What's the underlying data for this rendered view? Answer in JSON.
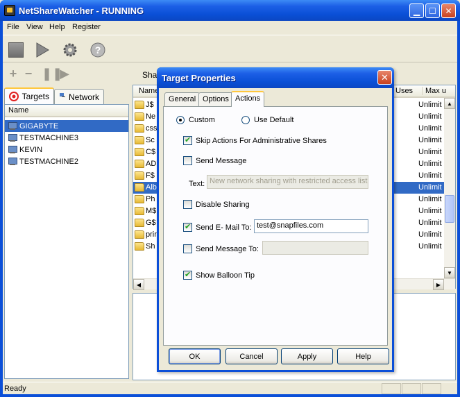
{
  "window": {
    "title": "NetShareWatcher - RUNNING"
  },
  "menu": [
    "File",
    "View",
    "Help",
    "Register"
  ],
  "toolbar": [
    "stop-icon",
    "play-icon",
    "settings-icon",
    "help-icon"
  ],
  "left_tabs": {
    "targets": "Targets",
    "network": "Network"
  },
  "target_list": {
    "header": "Name",
    "items": [
      "GIGABYTE",
      "TESTMACHINE3",
      "KEVIN",
      "TESTMACHINE2"
    ],
    "selected_index": 0
  },
  "right_tab_label": "Shar",
  "share_list": {
    "columns": {
      "name": "Name",
      "uses": "Uses",
      "max": "Max u"
    },
    "rows": [
      {
        "name": "J$",
        "max": "Unlimit"
      },
      {
        "name": "Ne",
        "max": "Unlimit"
      },
      {
        "name": "css",
        "max": "Unlimit"
      },
      {
        "name": "Sc",
        "max": "Unlimit"
      },
      {
        "name": "C$",
        "max": "Unlimit"
      },
      {
        "name": "AD",
        "max": "Unlimit"
      },
      {
        "name": "F$",
        "max": "Unlimit"
      },
      {
        "name": "Alb",
        "max": "Unlimit"
      },
      {
        "name": "Ph",
        "max": "Unlimit"
      },
      {
        "name": "M$",
        "max": "Unlimit"
      },
      {
        "name": "G$",
        "max": "Unlimit"
      },
      {
        "name": "prir",
        "max": "Unlimit"
      },
      {
        "name": "Sh",
        "max": "Unlimit"
      }
    ],
    "selected_index": 7
  },
  "status": {
    "text": "Ready"
  },
  "dialog": {
    "title": "Target Properties",
    "tabs": [
      "General",
      "Options",
      "Actions"
    ],
    "active_tab": "Actions",
    "radio_custom": "Custom",
    "radio_default": "Use Default",
    "skip_admin": "Skip Actions For Administrative  Shares",
    "send_message": "Send Message",
    "text_label": "Text:",
    "text_value": "New network sharing with restricted access list d",
    "disable_sharing": "Disable Sharing",
    "send_email": "Send E- Mail To:",
    "email_value": "test@snapfiles.com",
    "send_message_to": "Send Message To:",
    "send_message_to_value": "",
    "balloon": "Show Balloon Tip",
    "buttons": {
      "ok": "OK",
      "cancel": "Cancel",
      "apply": "Apply",
      "help": "Help"
    }
  }
}
